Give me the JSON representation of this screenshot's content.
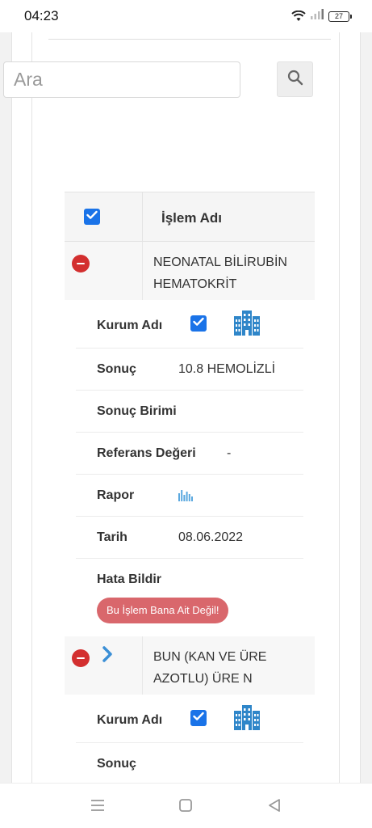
{
  "status_bar": {
    "time": "04:23",
    "battery": "27"
  },
  "search": {
    "placeholder": "Ara"
  },
  "table": {
    "header": "İşlem Adı",
    "records": [
      {
        "name": "NEONATAL BİLİRUBİN HEMATOKRİT",
        "expanded": true,
        "details": {
          "kurum_adi_label": "Kurum Adı",
          "sonuc_label": "Sonuç",
          "sonuc_value": "10.8 HEMOLİZLİ",
          "sonuc_birimi_label": "Sonuç Birimi",
          "sonuc_birimi_value": "",
          "referans_label": "Referans Değeri",
          "referans_value": "-",
          "rapor_label": "Rapor",
          "tarih_label": "Tarih",
          "tarih_value": "08.06.2022",
          "hata_label": "Hata Bildir",
          "hata_button": "Bu İşlem Bana Ait Değil!"
        }
      },
      {
        "name": "BUN (KAN VE ÜRE AZOTLU) ÜRE N",
        "expanded": true,
        "details": {
          "kurum_adi_label": "Kurum Adı",
          "sonuc_label": "Sonuç"
        }
      }
    ]
  },
  "colors": {
    "accent": "#1a73e8",
    "danger": "#d32f2f",
    "error_button": "#d9676c",
    "icon_blue": "#2f86c9"
  },
  "icons": [
    "search-icon",
    "checkbox-checked-icon",
    "minus-circle-icon",
    "building-icon",
    "bar-chart-icon",
    "chevron-right-icon"
  ]
}
